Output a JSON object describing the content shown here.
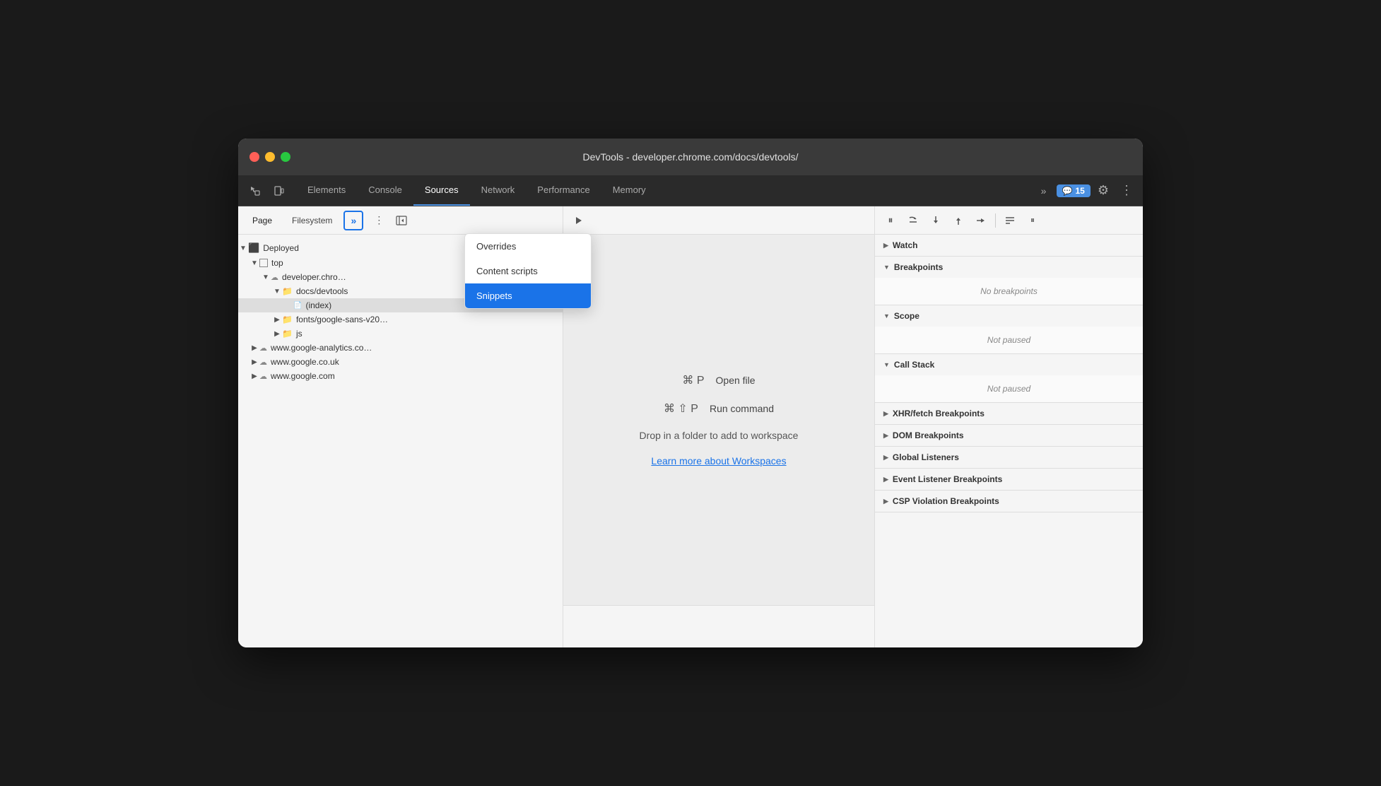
{
  "window": {
    "title": "DevTools - developer.chrome.com/docs/devtools/"
  },
  "traffic_lights": {
    "close": "close",
    "minimize": "minimize",
    "maximize": "maximize"
  },
  "tabs": {
    "items": [
      {
        "id": "elements",
        "label": "Elements",
        "active": false
      },
      {
        "id": "console",
        "label": "Console",
        "active": false
      },
      {
        "id": "sources",
        "label": "Sources",
        "active": true
      },
      {
        "id": "network",
        "label": "Network",
        "active": false
      },
      {
        "id": "performance",
        "label": "Performance",
        "active": false
      },
      {
        "id": "memory",
        "label": "Memory",
        "active": false
      }
    ],
    "more_label": "»",
    "notification_icon": "💬",
    "notification_count": "15",
    "settings_icon": "⚙",
    "kebab_icon": "⋮"
  },
  "sub_tabs": {
    "items": [
      {
        "id": "page",
        "label": "Page",
        "active": true
      },
      {
        "id": "filesystem",
        "label": "Filesystem",
        "active": false
      }
    ],
    "more_label": "»",
    "three_dots_label": "⋮",
    "toggle_left_label": "◀"
  },
  "dropdown": {
    "items": [
      {
        "id": "overrides",
        "label": "Overrides",
        "selected": false
      },
      {
        "id": "content-scripts",
        "label": "Content scripts",
        "selected": false
      },
      {
        "id": "snippets",
        "label": "Snippets",
        "selected": true
      }
    ]
  },
  "file_tree": {
    "items": [
      {
        "indent": 0,
        "arrow": "▼",
        "icon": "box",
        "label": "Deployed",
        "selected": false
      },
      {
        "indent": 1,
        "arrow": "▼",
        "icon": "square",
        "label": "top",
        "selected": false
      },
      {
        "indent": 2,
        "arrow": "▼",
        "icon": "cloud",
        "label": "developer.chro…",
        "selected": false
      },
      {
        "indent": 3,
        "arrow": "▼",
        "icon": "folder",
        "label": "docs/devtools",
        "selected": false
      },
      {
        "indent": 4,
        "arrow": "",
        "icon": "file",
        "label": "(index)",
        "selected": true
      },
      {
        "indent": 3,
        "arrow": "▶",
        "icon": "folder",
        "label": "fonts/google-sans-v20…",
        "selected": false
      },
      {
        "indent": 3,
        "arrow": "▶",
        "icon": "folder",
        "label": "js",
        "selected": false
      },
      {
        "indent": 1,
        "arrow": "▶",
        "icon": "cloud",
        "label": "www.google-analytics.co…",
        "selected": false
      },
      {
        "indent": 1,
        "arrow": "▶",
        "icon": "cloud",
        "label": "www.google.co.uk",
        "selected": false
      },
      {
        "indent": 1,
        "arrow": "▶",
        "icon": "cloud",
        "label": "www.google.com",
        "selected": false
      }
    ]
  },
  "center": {
    "shortcuts": [
      {
        "key": "⌘ P",
        "label": "Open file"
      },
      {
        "key": "⌘ ⇧ P",
        "label": "Run command"
      }
    ],
    "drop_text": "Drop in a folder to add to workspace",
    "link_text": "Learn more about Workspaces"
  },
  "right_panel": {
    "debugger_buttons": [
      {
        "id": "pause",
        "icon": "⏸",
        "label": "Pause"
      },
      {
        "id": "step-over",
        "icon": "↻",
        "label": "Step over"
      },
      {
        "id": "step-into",
        "icon": "↓",
        "label": "Step into"
      },
      {
        "id": "step-out",
        "icon": "↑",
        "label": "Step out"
      },
      {
        "id": "step",
        "icon": "→",
        "label": "Step"
      },
      {
        "sep": true
      },
      {
        "id": "breakpoints",
        "icon": "✎",
        "label": "Deactivate breakpoints"
      },
      {
        "id": "pause-exceptions",
        "icon": "⏸",
        "label": "Pause on exceptions"
      }
    ],
    "sections": [
      {
        "id": "watch",
        "label": "Watch",
        "arrow": "▶",
        "collapsed": true,
        "content": null
      },
      {
        "id": "breakpoints",
        "label": "Breakpoints",
        "arrow": "▼",
        "collapsed": false,
        "content": "No breakpoints",
        "content_style": "center"
      },
      {
        "id": "scope",
        "label": "Scope",
        "arrow": "▼",
        "collapsed": false,
        "content": "Not paused",
        "content_style": "italic"
      },
      {
        "id": "call-stack",
        "label": "Call Stack",
        "arrow": "▼",
        "collapsed": false,
        "content": "Not paused",
        "content_style": "italic"
      },
      {
        "id": "xhr-fetch",
        "label": "XHR/fetch Breakpoints",
        "arrow": "▶",
        "collapsed": true,
        "content": null
      },
      {
        "id": "dom-breakpoints",
        "label": "DOM Breakpoints",
        "arrow": "▶",
        "collapsed": true,
        "content": null
      },
      {
        "id": "global-listeners",
        "label": "Global Listeners",
        "arrow": "▶",
        "collapsed": true,
        "content": null
      },
      {
        "id": "event-listener-breakpoints",
        "label": "Event Listener Breakpoints",
        "arrow": "▶",
        "collapsed": true,
        "content": null
      },
      {
        "id": "csp-violation",
        "label": "CSP Violation Breakpoints",
        "arrow": "▶",
        "collapsed": true,
        "content": null
      }
    ]
  },
  "icons": {
    "chevron_right": "▶",
    "chevron_down": "▼",
    "cursor": "↖",
    "layers": "⧉",
    "more": "»",
    "three_dots": "⋮",
    "panel_left": "◀",
    "panel_right": "▶"
  }
}
